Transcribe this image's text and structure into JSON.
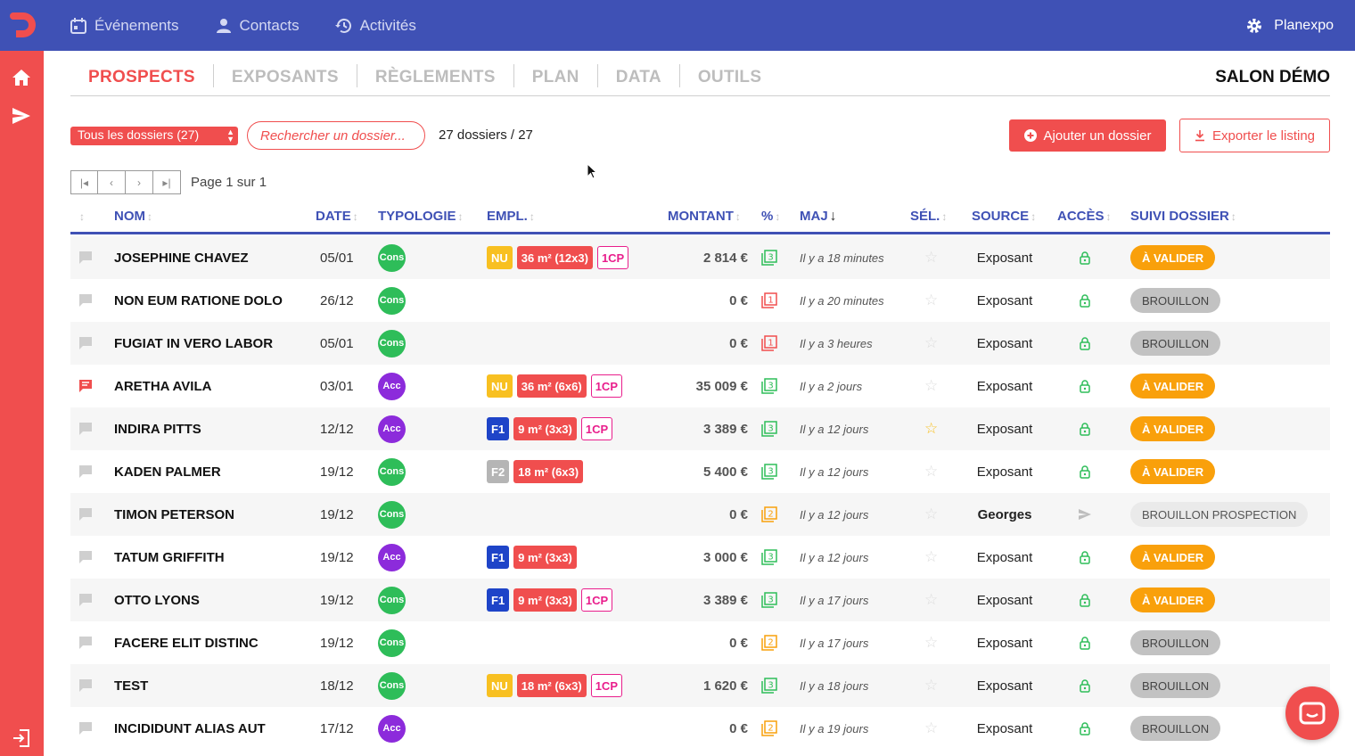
{
  "topbar": {
    "nav": [
      {
        "label": "Événements",
        "icon": "calendar-icon"
      },
      {
        "label": "Contacts",
        "icon": "person-icon"
      },
      {
        "label": "Activités",
        "icon": "history-icon"
      }
    ],
    "org_name": "Planexpo"
  },
  "tabs": [
    "PROSPECTS",
    "EXPOSANTS",
    "RÈGLEMENTS",
    "PLAN",
    "DATA",
    "OUTILS"
  ],
  "active_tab": "PROSPECTS",
  "salon_name": "SALON DÉMO",
  "controls": {
    "filter_value": "Tous les dossiers (27)",
    "search_placeholder": "Rechercher un dossier...",
    "count_text": "27 dossiers / 27",
    "add_label": "Ajouter un dossier",
    "export_label": "Exporter le listing"
  },
  "pager": {
    "label": "Page 1 sur 1"
  },
  "columns": {
    "nom": "NOM",
    "date": "DATE",
    "typologie": "TYPOLOGIE",
    "empl": "EMPL.",
    "montant": "MONTANT",
    "pct": "%",
    "maj": "MAJ",
    "sel": "SÉL.",
    "source": "SOURCE",
    "acces": "ACCÈS",
    "suivi": "SUIVI DOSSIER"
  },
  "colors": {
    "primary": "#3f51b5",
    "accent": "#f04e4e",
    "cons": "#2ebd59",
    "acc": "#8c2bdb",
    "orange": "#f9a00b",
    "green_icon": "#2ebd59",
    "red_icon": "#f04e4e"
  },
  "rows": [
    {
      "comment": false,
      "nom": "JOSEPHINE CHAVEZ",
      "date": "05/01",
      "typo": "Cons",
      "empl": [
        "NU",
        "36 m² (12x3)",
        "1CP"
      ],
      "montant": "2 814 €",
      "pct": "3",
      "pct_color": "green",
      "maj": "Il y a 18 minutes",
      "sel": false,
      "source": "Exposant",
      "acces": "lock",
      "suivi": "À VALIDER",
      "suivi_type": "valider"
    },
    {
      "comment": false,
      "nom": "NON EUM RATIONE DOLO",
      "date": "26/12",
      "typo": "Cons",
      "empl": [],
      "montant": "0 €",
      "pct": "1",
      "pct_color": "red",
      "maj": "Il y a 20 minutes",
      "sel": false,
      "source": "Exposant",
      "acces": "lock",
      "suivi": "BROUILLON",
      "suivi_type": "brouillon"
    },
    {
      "comment": false,
      "nom": "FUGIAT IN VERO LABOR",
      "date": "05/01",
      "typo": "Cons",
      "empl": [],
      "montant": "0 €",
      "pct": "1",
      "pct_color": "red",
      "maj": "Il y a 3 heures",
      "sel": false,
      "source": "Exposant",
      "acces": "lock",
      "suivi": "BROUILLON",
      "suivi_type": "brouillon"
    },
    {
      "comment": true,
      "nom": "ARETHA AVILA",
      "date": "03/01",
      "typo": "Acc",
      "empl": [
        "NU",
        "36 m² (6x6)",
        "1CP"
      ],
      "montant": "35 009 €",
      "pct": "3",
      "pct_color": "green",
      "maj": "Il y a 2 jours",
      "sel": false,
      "source": "Exposant",
      "acces": "lock",
      "suivi": "À VALIDER",
      "suivi_type": "valider"
    },
    {
      "comment": false,
      "nom": "INDIRA PITTS",
      "date": "12/12",
      "typo": "Acc",
      "empl": [
        "F1",
        "9 m² (3x3)",
        "1CP"
      ],
      "montant": "3 389 €",
      "pct": "3",
      "pct_color": "green",
      "maj": "Il y a 12 jours",
      "sel": true,
      "source": "Exposant",
      "acces": "lock",
      "suivi": "À VALIDER",
      "suivi_type": "valider"
    },
    {
      "comment": false,
      "nom": "KADEN PALMER",
      "date": "19/12",
      "typo": "Cons",
      "empl": [
        "F2",
        "18 m² (6x3)"
      ],
      "montant": "5 400 €",
      "pct": "3",
      "pct_color": "green",
      "maj": "Il y a 12 jours",
      "sel": false,
      "source": "Exposant",
      "acces": "lock",
      "suivi": "À VALIDER",
      "suivi_type": "valider"
    },
    {
      "comment": false,
      "nom": "TIMON PETERSON",
      "date": "19/12",
      "typo": "Cons",
      "empl": [],
      "montant": "0 €",
      "pct": "2",
      "pct_color": "orange",
      "maj": "Il y a 12 jours",
      "sel": false,
      "source": "Georges",
      "source_bold": true,
      "acces": "send",
      "suivi": "BROUILLON PROSPECTION",
      "suivi_type": "prospection"
    },
    {
      "comment": false,
      "nom": "TATUM GRIFFITH",
      "date": "19/12",
      "typo": "Acc",
      "empl": [
        "F1",
        "9 m² (3x3)"
      ],
      "montant": "3 000 €",
      "pct": "3",
      "pct_color": "green",
      "maj": "Il y a 12 jours",
      "sel": false,
      "source": "Exposant",
      "acces": "lock",
      "suivi": "À VALIDER",
      "suivi_type": "valider"
    },
    {
      "comment": false,
      "nom": "OTTO LYONS",
      "date": "19/12",
      "typo": "Cons",
      "empl": [
        "F1",
        "9 m² (3x3)",
        "1CP"
      ],
      "montant": "3 389 €",
      "pct": "3",
      "pct_color": "green",
      "maj": "Il y a 17 jours",
      "sel": false,
      "source": "Exposant",
      "acces": "lock",
      "suivi": "À VALIDER",
      "suivi_type": "valider"
    },
    {
      "comment": false,
      "nom": "FACERE ELIT DISTINC",
      "date": "19/12",
      "typo": "Cons",
      "empl": [],
      "montant": "0 €",
      "pct": "2",
      "pct_color": "orange",
      "maj": "Il y a 17 jours",
      "sel": false,
      "source": "Exposant",
      "acces": "lock",
      "suivi": "BROUILLON",
      "suivi_type": "brouillon"
    },
    {
      "comment": false,
      "nom": "TEST",
      "date": "18/12",
      "typo": "Cons",
      "empl": [
        "NU",
        "18 m² (6x3)",
        "1CP"
      ],
      "montant": "1 620 €",
      "pct": "3",
      "pct_color": "green",
      "maj": "Il y a 18 jours",
      "sel": false,
      "source": "Exposant",
      "acces": "lock",
      "suivi": "BROUILLON",
      "suivi_type": "brouillon"
    },
    {
      "comment": false,
      "nom": "INCIDIDUNT ALIAS AUT",
      "date": "17/12",
      "typo": "Acc",
      "empl": [],
      "montant": "0 €",
      "pct": "2",
      "pct_color": "orange",
      "maj": "Il y a 19 jours",
      "sel": false,
      "source": "Exposant",
      "acces": "lock",
      "suivi": "BROUILLON",
      "suivi_type": "brouillon"
    }
  ]
}
